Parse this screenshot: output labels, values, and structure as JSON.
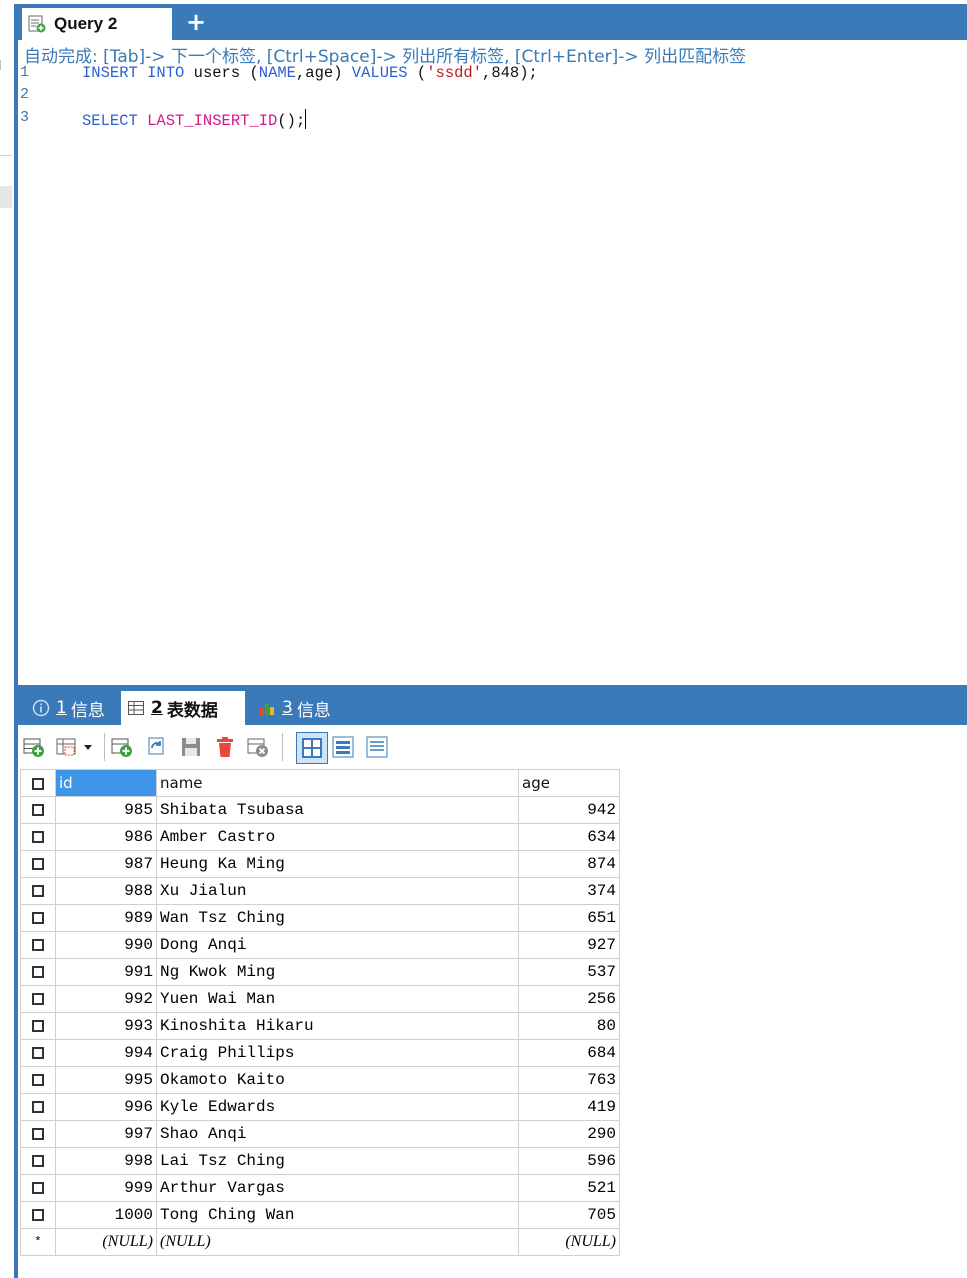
{
  "query_tab": {
    "title": "Query 2",
    "add_tab": "+"
  },
  "editor": {
    "autocomplete_hint": "自动完成: [Tab]-> 下一个标签, [Ctrl+Space]-> 列出所有标签, [Ctrl+Enter]-> 列出匹配标签",
    "lines": [
      {
        "no": "1",
        "tokens": [
          {
            "t": "INSERT",
            "c": "kw"
          },
          {
            "t": " ",
            "c": "plain"
          },
          {
            "t": "INTO",
            "c": "kw"
          },
          {
            "t": " users (",
            "c": "plain"
          },
          {
            "t": "NAME",
            "c": "kw"
          },
          {
            "t": ",age) ",
            "c": "plain"
          },
          {
            "t": "VALUES",
            "c": "kw"
          },
          {
            "t": " (",
            "c": "plain"
          },
          {
            "t": "'ssdd'",
            "c": "str"
          },
          {
            "t": ",848);",
            "c": "plain"
          }
        ]
      },
      {
        "no": "2",
        "tokens": []
      },
      {
        "no": "3",
        "tokens": [
          {
            "t": "SELECT",
            "c": "kw"
          },
          {
            "t": " ",
            "c": "plain"
          },
          {
            "t": "LAST_INSERT_ID",
            "c": "fn"
          },
          {
            "t": "();",
            "c": "plain"
          }
        ]
      }
    ]
  },
  "result_tabs": [
    {
      "num": "1",
      "label": "信息"
    },
    {
      "num": "2",
      "label": "表数据"
    },
    {
      "num": "3",
      "label": "信息"
    }
  ],
  "grid": {
    "columns": [
      "id",
      "name",
      "age"
    ],
    "rows": [
      {
        "id": "985",
        "name": "Shibata Tsubasa",
        "age": "942"
      },
      {
        "id": "986",
        "name": "Amber Castro",
        "age": "634"
      },
      {
        "id": "987",
        "name": "Heung Ka Ming",
        "age": "874"
      },
      {
        "id": "988",
        "name": "Xu Jialun",
        "age": "374"
      },
      {
        "id": "989",
        "name": "Wan Tsz Ching",
        "age": "651"
      },
      {
        "id": "990",
        "name": "Dong Anqi",
        "age": "927"
      },
      {
        "id": "991",
        "name": "Ng Kwok Ming",
        "age": "537"
      },
      {
        "id": "992",
        "name": "Yuen Wai Man",
        "age": "256"
      },
      {
        "id": "993",
        "name": "Kinoshita Hikaru",
        "age": "80"
      },
      {
        "id": "994",
        "name": "Craig Phillips",
        "age": "684"
      },
      {
        "id": "995",
        "name": "Okamoto Kaito",
        "age": "763"
      },
      {
        "id": "996",
        "name": "Kyle Edwards",
        "age": "419"
      },
      {
        "id": "997",
        "name": "Shao Anqi",
        "age": "290"
      },
      {
        "id": "998",
        "name": "Lai Tsz Ching",
        "age": "596"
      },
      {
        "id": "999",
        "name": "Arthur Vargas",
        "age": "521"
      },
      {
        "id": "1000",
        "name": "Tong Ching Wan",
        "age": "705"
      }
    ],
    "new_row": {
      "marker": "*",
      "id": "(NULL)",
      "name": "(NULL)",
      "age": "(NULL)"
    }
  },
  "colors": {
    "accent": "#3a7ab8",
    "selected_header": "#3f95e8",
    "keyword": "#2c5fd4",
    "function": "#d6178a",
    "string": "#c41a16"
  },
  "icons": {
    "query_tab": "query-file-icon",
    "info1": "info-circle-icon",
    "data2": "table-grid-icon",
    "info3": "chart-bars-icon",
    "toolbar": [
      "add-row-icon",
      "filter-dropdown-icon",
      "insert-row-icon",
      "refresh-icon",
      "save-icon",
      "delete-icon",
      "cancel-icon",
      "grid-view-icon",
      "form-view-icon",
      "text-view-icon"
    ]
  }
}
